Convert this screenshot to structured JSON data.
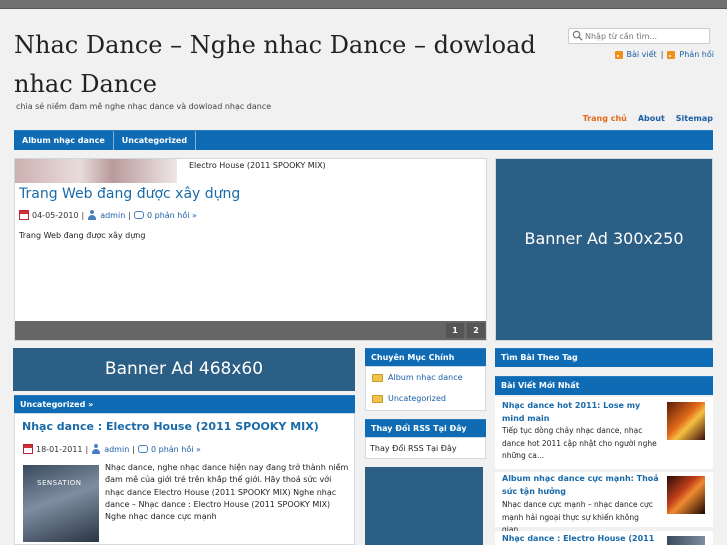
{
  "header": {
    "site_title": "Nhac Dance – Nghe nhac Dance – dowload nhac Dance",
    "tagline": "chia sẻ niềm đam mê nghe nhạc dance và dowload nhạc dance",
    "search_placeholder": "Nhập từ cần tìm...",
    "rss_posts": "Bài viết",
    "rss_comments": "Phản hồi",
    "rss_sep": "|"
  },
  "page_nav": [
    "Trang chủ",
    "About",
    "Sitemap"
  ],
  "category_nav": [
    "Album nhạc dance",
    "Uncategorized"
  ],
  "slider": {
    "thumb_caption": "Electro House (2011 SPOOKY MIX)",
    "title": "Trang Web đang được xây dựng",
    "date": "04-05-2010",
    "author": "admin",
    "comments": "0 phản hồi »",
    "excerpt": "Trang Web đang được xây dựng",
    "pages": [
      "1",
      "2"
    ]
  },
  "ads": {
    "ad300": "Banner Ad 300x250",
    "ad468": "Banner Ad 468x60"
  },
  "main_section": {
    "header": "Uncategorized »",
    "post_title": "Nhạc dance : Electro House (2011 SPOOKY MIX)",
    "date": "18-01-2011",
    "author": "admin",
    "comments": "0 phản hồi »",
    "image_label": "SENSATION",
    "excerpt": "Nhạc dance, nghe nhạc dance hiện nay đang trở thành niềm đam mê của giới trẻ trên khắp thế giới. Hãy thoả sức với nhạc dance Electro House (2011 SPOOKY MIX) Nghe nhạc dance – Nhạc dance : Electro House (2011 SPOOKY MIX) Nghe nhạc dance cực mạnh"
  },
  "sidebar_mid": {
    "categories_title": "Chuyên Mục Chính",
    "categories": [
      "Album nhạc dance",
      "Uncategorized"
    ],
    "rss_title": "Thay Đổi RSS Tại Đây",
    "rss_text": "Thay Đổi RSS Tại Đây"
  },
  "sidebar_right": {
    "tags_title": "Tìm Bài Theo Tag",
    "recent_title": "Bài Viết Mới Nhất",
    "recent": [
      {
        "title": "Nhạc dance hot 2011: Lose my mind main",
        "text": "Tiếp tục dòng chảy nhạc dance, nhạc dance hot 2011 cập nhật cho người nghe những ca..."
      },
      {
        "title": "Album nhạc dance cực mạnh: Thoả sức tận hưởng",
        "text": "Nhạc dance cực mạnh – nhạc dance cực mạnh hải ngoại thực sự khiến không gian..."
      },
      {
        "title": "Nhạc dance : Electro House (2011",
        "text": ""
      }
    ]
  },
  "colors": {
    "nav_blue": "#0f6cb4",
    "link_blue": "#1a5ea8",
    "ad_blue": "#2c5f85",
    "active_orange": "#e06a1a"
  },
  "icons": [
    "search-icon",
    "rss-icon",
    "calendar-icon",
    "user-icon",
    "comment-icon",
    "folder-icon"
  ]
}
